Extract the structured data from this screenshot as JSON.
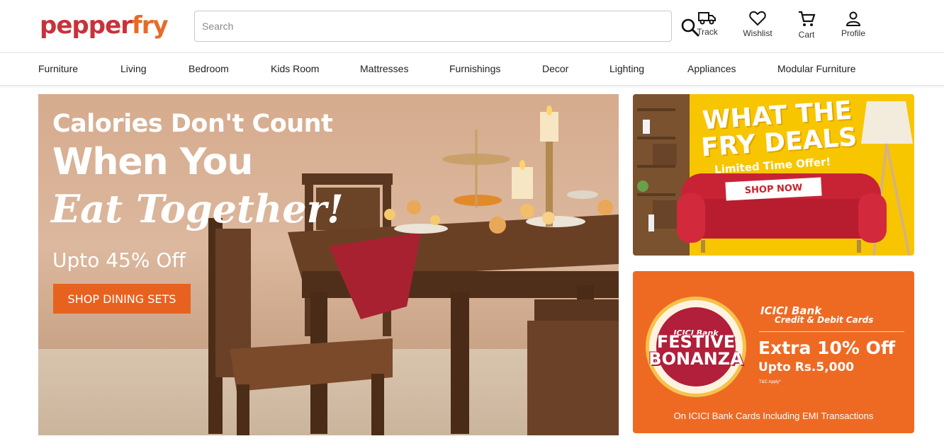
{
  "brand": {
    "logo_pre": "pepper",
    "logo_post": "fry",
    "primary_color": "#c8323a",
    "accent_color": "#e86a2a"
  },
  "header": {
    "search_placeholder": "Search",
    "actions": [
      {
        "label": "Track",
        "icon": "truck-icon"
      },
      {
        "label": "Wishlist",
        "icon": "heart-icon"
      },
      {
        "label": "Cart",
        "icon": "cart-icon"
      },
      {
        "label": "Profile",
        "icon": "user-icon"
      }
    ]
  },
  "nav": {
    "items": [
      "Furniture",
      "Living",
      "Bedroom",
      "Kids Room",
      "Mattresses",
      "Furnishings",
      "Decor",
      "Lighting",
      "Appliances",
      "Modular Furniture"
    ]
  },
  "hero": {
    "line1": "Calories Don't Count",
    "line2": "When You",
    "line3": "Eat Together!",
    "offer": "Upto 45% Off",
    "cta": "SHOP DINING SETS",
    "cta_color": "#e8621f"
  },
  "fry_deals": {
    "title": "WHAT THE FRY DEALS",
    "subtitle": "Limited Time Offer!",
    "cta": "SHOP NOW",
    "bg_color": "#f7c600"
  },
  "icici": {
    "badge_bank": "ICICI Bank",
    "badge_title": "FESTIVE BONANZA",
    "brand": "ICICI Bank",
    "brand_sub": "Credit & Debit Cards",
    "offer": "Extra 10% Off",
    "upto": "Upto Rs.5,000",
    "tc": "T&C Apply*",
    "footer": "On ICICI Bank Cards Including EMI Transactions",
    "bg_color": "#ee6a23"
  }
}
